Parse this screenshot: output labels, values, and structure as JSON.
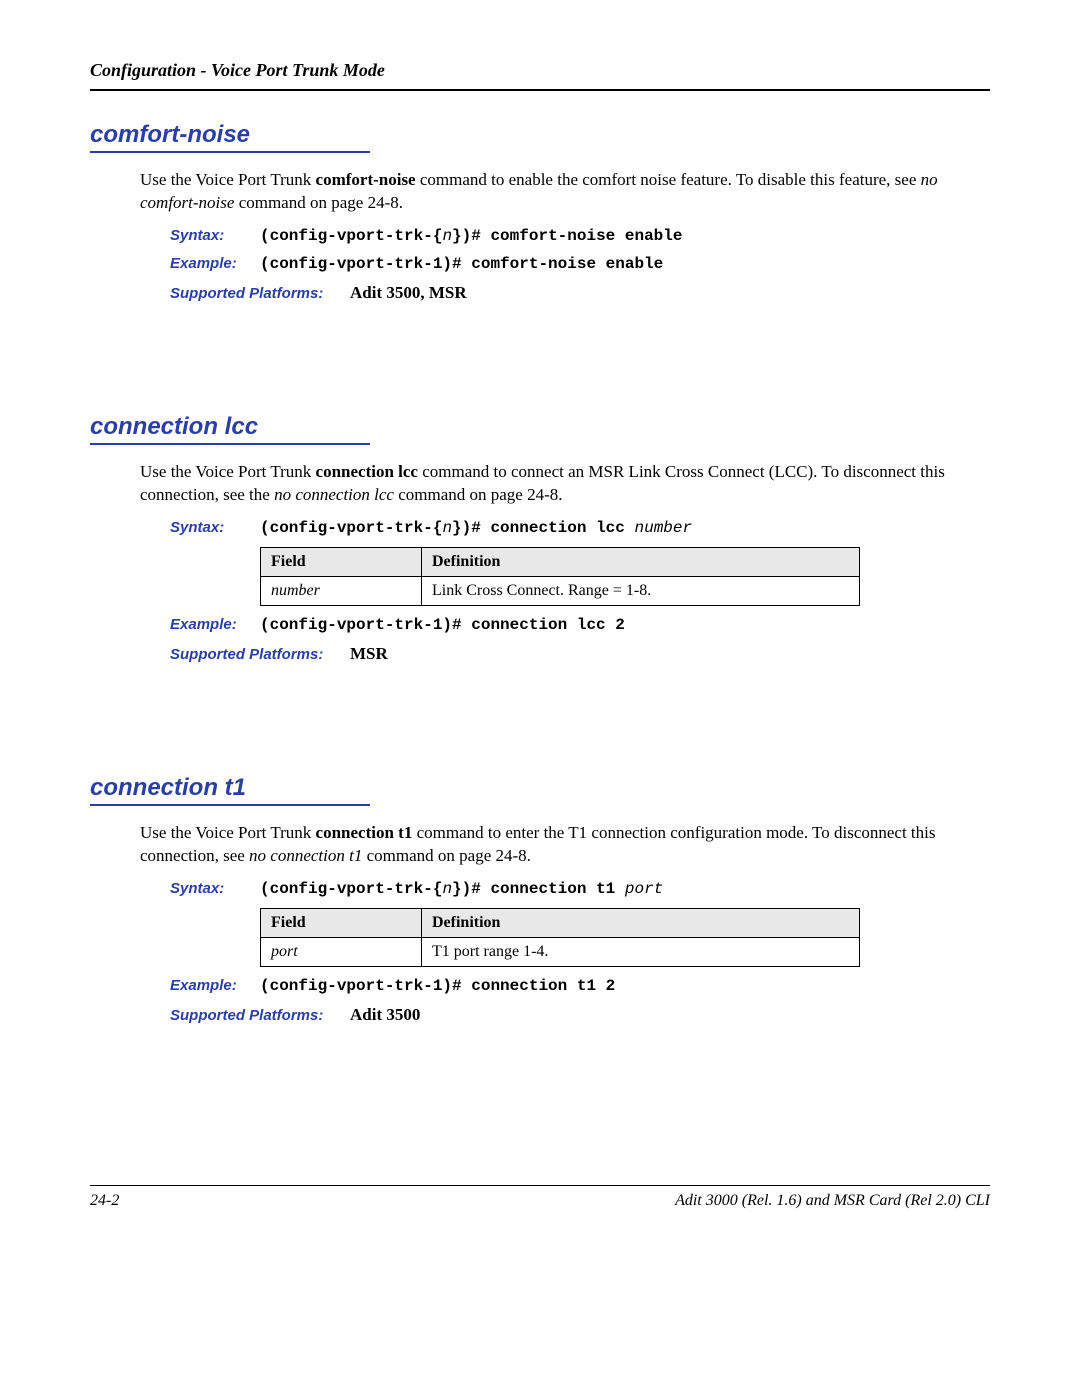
{
  "header": {
    "title": "Configuration - Voice Port Trunk Mode"
  },
  "sections": {
    "comfort_noise": {
      "title": "comfort-noise",
      "intro_prefix": "Use the Voice Port Trunk ",
      "intro_bold": "comfort-noise",
      "intro_mid": " command to enable the comfort noise feature. To disable this feature, see ",
      "intro_italic": "no comfort-noise",
      "intro_suffix": " command on page 24-8.",
      "syntax_prefix": "(config-vport-trk-{",
      "syntax_var": "n",
      "syntax_suffix": "})# comfort-noise enable",
      "example": "(config-vport-trk-1)# comfort-noise enable",
      "platforms": "Adit 3500, MSR"
    },
    "connection_lcc": {
      "title": "connection lcc",
      "intro_prefix": "Use the Voice Port Trunk ",
      "intro_bold": "connection lcc",
      "intro_mid": " command to connect an MSR Link Cross Connect (LCC).  To disconnect this connection, see the ",
      "intro_italic": "no connection lcc",
      "intro_suffix": " command on page 24-8.",
      "syntax_prefix": "(config-vport-trk-{",
      "syntax_var": "n",
      "syntax_suffix": "})# connection lcc ",
      "syntax_arg": "number",
      "field": "number",
      "definition": "Link Cross Connect.  Range = 1-8.",
      "example": "(config-vport-trk-1)# connection lcc 2",
      "platforms": "MSR"
    },
    "connection_t1": {
      "title": "connection t1",
      "intro_prefix": "Use the Voice Port Trunk ",
      "intro_bold": "connection t1",
      "intro_mid": " command to enter the T1 connection configuration mode. To disconnect this connection, see ",
      "intro_italic": "no connection t1",
      "intro_suffix": " command on page 24-8.",
      "syntax_prefix": "(config-vport-trk-{",
      "syntax_var": "n",
      "syntax_suffix": "})# connection t1 ",
      "syntax_arg": "port",
      "field": "port",
      "definition": "T1 port range 1-4.",
      "example": "(config-vport-trk-1)# connection t1 2",
      "platforms": "Adit 3500"
    }
  },
  "labels": {
    "syntax": "Syntax:",
    "example": "Example:",
    "supported": "Supported Platforms:",
    "field": "Field",
    "definition": "Definition"
  },
  "footer": {
    "page": "24-2",
    "product": "Adit 3000 (Rel. 1.6) and MSR Card (Rel 2.0) CLI"
  }
}
